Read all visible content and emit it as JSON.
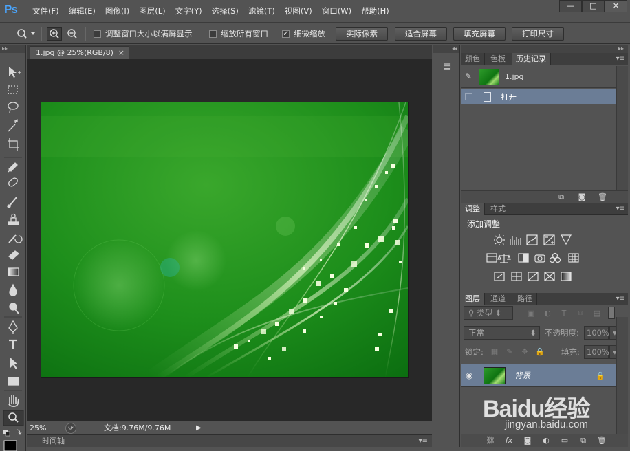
{
  "app": {
    "logo": "Ps"
  },
  "menu": [
    "文件(F)",
    "编辑(E)",
    "图像(I)",
    "图层(L)",
    "文字(Y)",
    "选择(S)",
    "滤镜(T)",
    "视图(V)",
    "窗口(W)",
    "帮助(H)"
  ],
  "window_controls": {
    "minimize": "—",
    "maximize": "□",
    "close": "✕"
  },
  "options_bar": {
    "tool_icon": "zoom-tool-icon",
    "checks": [
      {
        "label": "调整窗口大小以满屏显示",
        "checked": false
      },
      {
        "label": "缩放所有窗口",
        "checked": false
      },
      {
        "label": "细微缩放",
        "checked": true
      }
    ],
    "buttons": [
      "实际像素",
      "适合屏幕",
      "填充屏幕",
      "打印尺寸"
    ]
  },
  "tools": [
    "move-tool-icon",
    "marquee-tool-icon",
    "lasso-tool-icon",
    "magic-wand-icon",
    "crop-tool-icon",
    "eyedropper-icon",
    "healing-brush-icon",
    "brush-tool-icon",
    "clone-stamp-icon",
    "history-brush-icon",
    "eraser-icon",
    "gradient-tool-icon",
    "blur-tool-icon",
    "dodge-tool-icon",
    "pen-tool-icon",
    "type-tool-icon",
    "path-selection-icon",
    "rectangle-tool-icon",
    "hand-tool-icon",
    "zoom-tool-icon"
  ],
  "document": {
    "tab_title": "1.jpg @ 25%(RGB/8)",
    "close": "×",
    "zoom": "25%",
    "info": "文档:9.76M/9.76M",
    "timeline_label": "时间轴"
  },
  "history_panel": {
    "tabs": [
      "颜色",
      "色板",
      "历史记录"
    ],
    "active_tab": 2,
    "snapshot_name": "1.jpg",
    "steps": [
      "打开"
    ]
  },
  "adjustments_panel": {
    "tabs": [
      "调整",
      "样式"
    ],
    "active_tab": 0,
    "title": "添加调整"
  },
  "layers_panel": {
    "tabs": [
      "图层",
      "通道",
      "路径"
    ],
    "active_tab": 0,
    "filter_kind": "类型",
    "blend_mode": "正常",
    "opacity_label": "不透明度:",
    "opacity_value": "100%",
    "lock_label": "锁定:",
    "fill_label": "填充:",
    "fill_value": "100%",
    "layers": [
      {
        "name": "背景",
        "visible": true,
        "locked": true
      }
    ]
  },
  "watermark": {
    "logo": "Baidu经验",
    "sub": "jingyan.baidu.com"
  },
  "colors": {
    "ui_bg": "#535353",
    "selection": "#6b7d96",
    "canvas_bg": "#282828",
    "art_green": "#1c8f1c"
  }
}
